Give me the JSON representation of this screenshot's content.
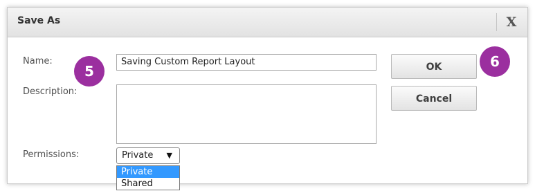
{
  "dialog": {
    "title": "Save As",
    "close_label": "X"
  },
  "form": {
    "name_label": "Name:",
    "name_value": "Saving Custom Report Layout",
    "description_label": "Description:",
    "description_value": "",
    "permissions_label": "Permissions:",
    "permissions_selected": "Private",
    "permissions_options": [
      "Private",
      "Shared"
    ],
    "permissions_arrow_icon": "triangle-down-icon"
  },
  "buttons": {
    "ok_label": "OK",
    "cancel_label": "Cancel"
  },
  "annotations": {
    "step_name": "5",
    "step_ok": "6",
    "badge_color": "#9b2f9f"
  },
  "colors": {
    "selected_option_bg": "#3399ff"
  }
}
